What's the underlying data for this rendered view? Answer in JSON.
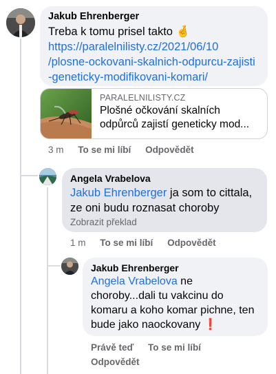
{
  "comments": [
    {
      "author": "Jakub Ehrenberger",
      "text": "Treba k tomu prisel takto",
      "emoji": "🤞",
      "link_lines": [
        "https://paralelnilisty.cz/2021/06/10",
        "/plosne-ockovani-skalnich-odpurcu-zajisti",
        "-geneticky-modifikovani-komari/"
      ],
      "preview": {
        "domain": "PARALELNILISTY.CZ",
        "title_line1": "Plošné očkování skalních",
        "title_line2": "odpůrců zajistí geneticky mod..."
      },
      "time": "3 m",
      "like_label": "To se mi líbí",
      "reply_label": "Odpovědět"
    },
    {
      "author": "Angela Vrabelova",
      "mention": "Jakub Ehrenberger",
      "text_line1": " ja som to cittala,",
      "text_line2": "ze oni budu roznasat choroby",
      "translate": "Zobrazit překlad",
      "time": "1 m",
      "like_label": "To se mi líbí",
      "reply_label": "Odpovědět"
    },
    {
      "author": "Jakub Ehrenberger",
      "mention": "Angela Vrabelova",
      "text_line1": " ne",
      "text_line2": "choroby...dali tu vakcinu do",
      "text_line3": "komaru a koho komar pichne, ten",
      "text_line4": "bude jako naockovany",
      "emoji": "❗",
      "time": "Právě teď",
      "like_label": "To se mi líbí",
      "reply_label": "Odpovědět"
    }
  ],
  "colors": {
    "link": "#216fdb",
    "bubble": "#f0f2f5",
    "bubble_highlight": "#e4e6eb",
    "meta": "#65676b",
    "thread": "#d7dadf"
  }
}
